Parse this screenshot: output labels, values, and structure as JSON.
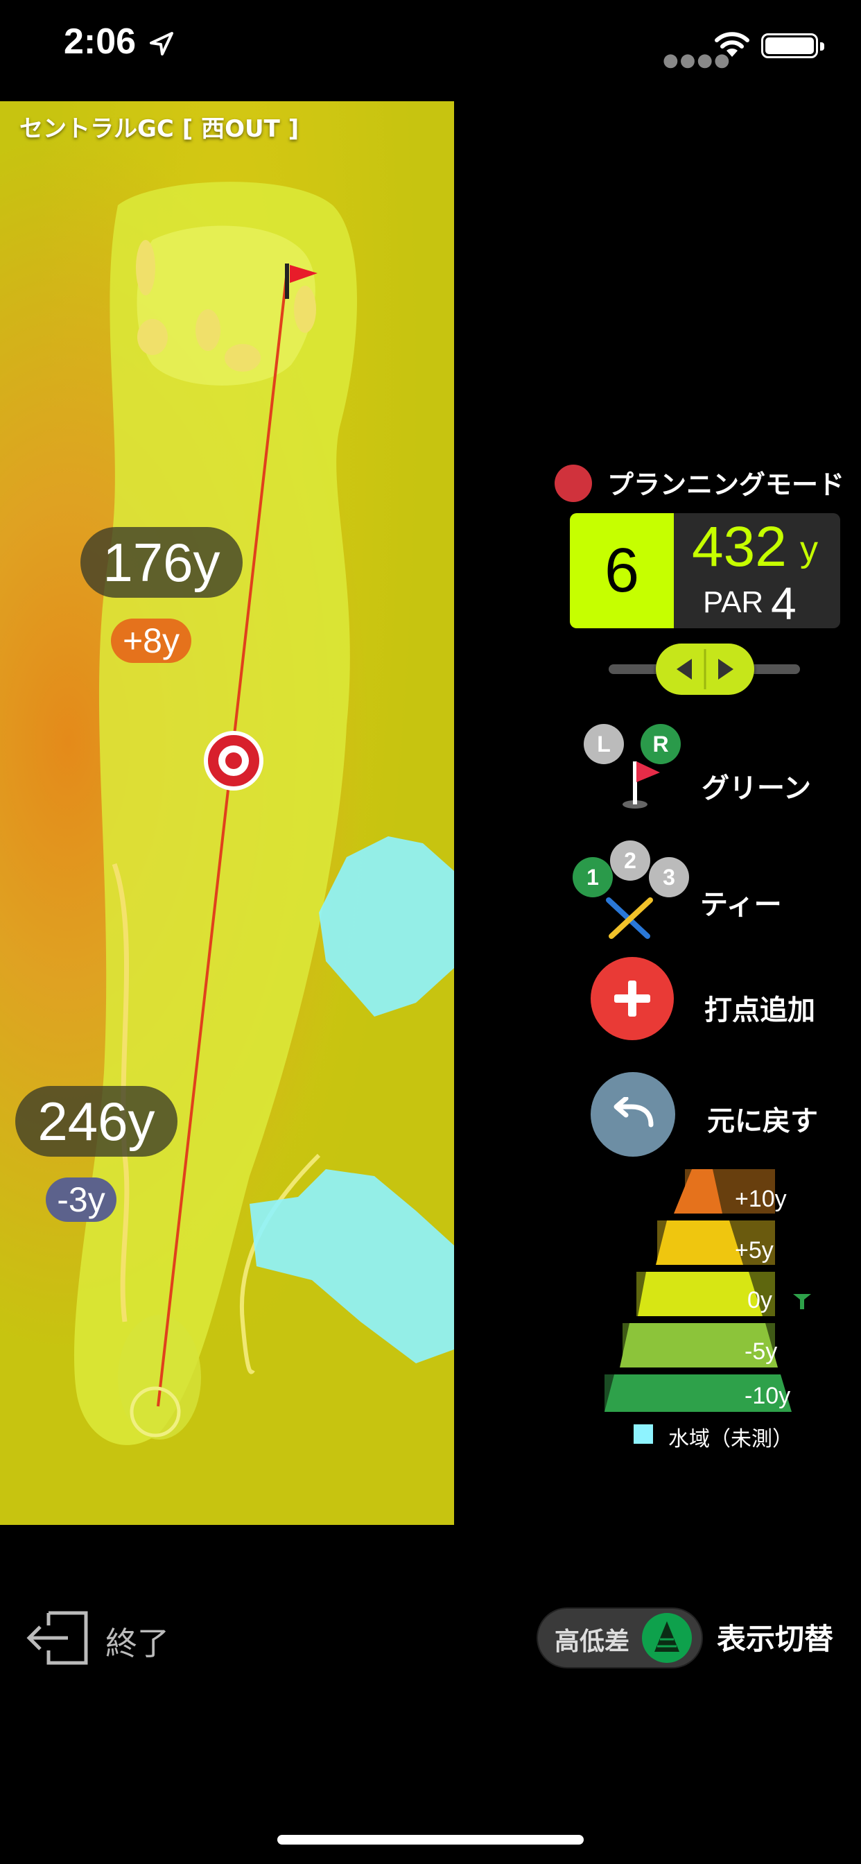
{
  "status": {
    "time": "2:06"
  },
  "course": {
    "title": "セントラルGC [ 西OUT ]"
  },
  "map": {
    "pin_distance": "176y",
    "pin_elevation": "+8y",
    "tee_distance": "246y",
    "tee_elevation": "-3y",
    "colors": {
      "plus": "#e5721c",
      "minus": "#5c628c"
    }
  },
  "mode": {
    "label": "プランニングモード",
    "color": "#d0323c"
  },
  "hole": {
    "number": "6",
    "yardage": "432",
    "yard_unit": "y",
    "par_label": "PAR",
    "par": "4"
  },
  "menu": {
    "green": {
      "label": "グリーン",
      "badges": [
        "L",
        "R"
      ]
    },
    "tee": {
      "label": "ティー",
      "badges": [
        "1",
        "2",
        "3"
      ]
    },
    "add_point": {
      "label": "打点追加"
    },
    "undo": {
      "label": "元に戻す"
    }
  },
  "legend": {
    "levels": [
      {
        "label": "+10y",
        "color": "#e5721c"
      },
      {
        "label": "+5y",
        "color": "#efc60f"
      },
      {
        "label": "0y",
        "color": "#d7e614"
      },
      {
        "label": "-5y",
        "color": "#8cc43a"
      },
      {
        "label": "-10y",
        "color": "#2ea14a"
      }
    ],
    "water_label": "水域（未測）",
    "water_color": "#8ef3ff"
  },
  "footer": {
    "exit_label": "終了",
    "toggle_label": "高低差",
    "switch_label": "表示切替"
  }
}
